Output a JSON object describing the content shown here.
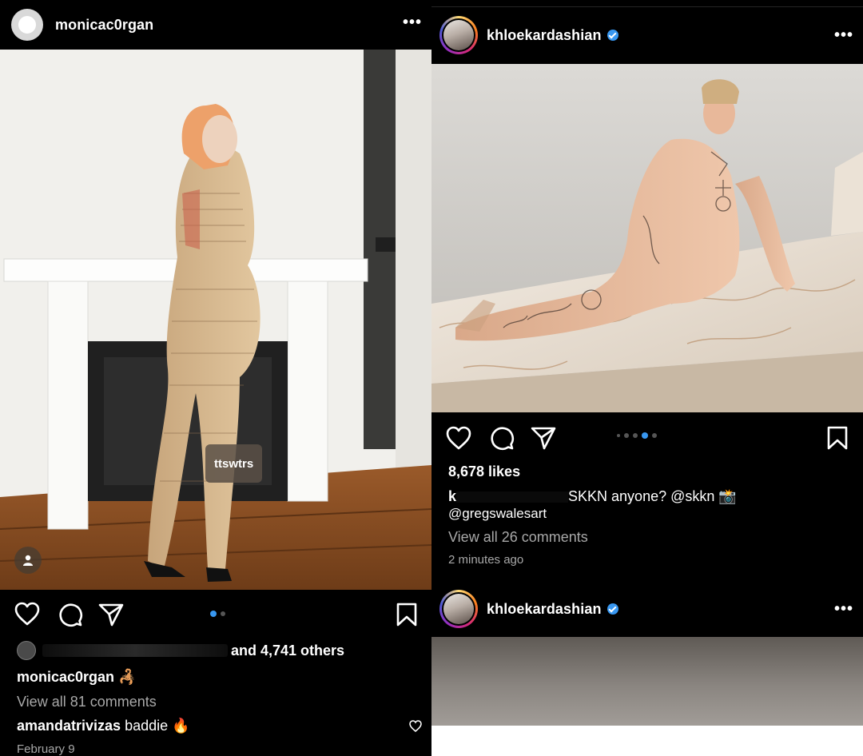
{
  "left_post": {
    "username": "monicac0rgan",
    "more_label": "•••",
    "photo_tag": "ttswtrs",
    "liked_by": "and 4,741 others",
    "caption_user": "monicac0rgan",
    "caption_emoji": "🦂",
    "view_comments": "View all 81 comments",
    "comment_user": "amandatrivizas",
    "comment_text": "baddie 🔥",
    "date": "February 9",
    "carousel_count": 2,
    "carousel_active": 0
  },
  "right_post": {
    "username": "khloekardashian",
    "more_label": "•••",
    "likes": "8,678 likes",
    "caption_start": "k",
    "caption_text": "SKKN anyone? @skkn 📸",
    "caption_line2": "@gregswalesart",
    "view_comments": "View all 26 comments",
    "time_ago": "2 minutes ago",
    "carousel_count": 5,
    "carousel_active": 3
  },
  "next_post": {
    "username": "khloekardashian",
    "more_label": "•••"
  },
  "colors": {
    "accent": "#3897f0",
    "secondary_text": "#a8a8a8",
    "background": "#000000"
  }
}
